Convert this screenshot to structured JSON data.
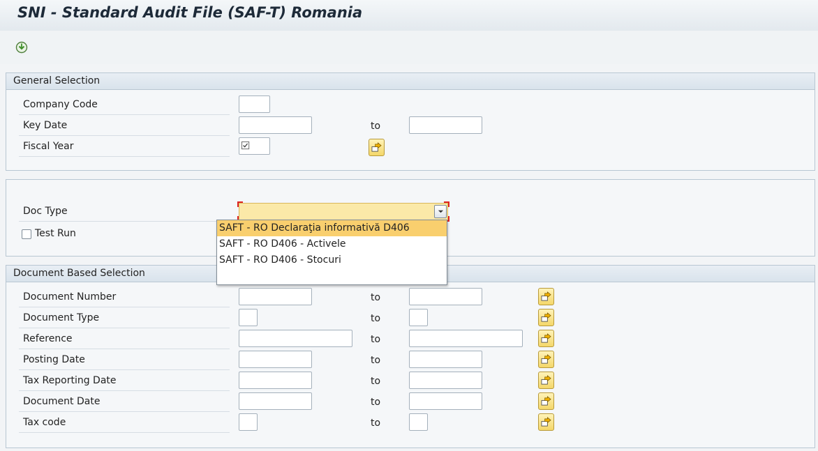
{
  "title": "SNI - Standard Audit File (SAF-T) Romania",
  "toolbar": {
    "execute_icon": "execute-icon"
  },
  "general": {
    "header": "General Selection",
    "company_code_label": "Company Code",
    "key_date_label": "Key Date",
    "key_date_to": "to",
    "fiscal_year_label": "Fiscal Year"
  },
  "options": {
    "doc_type_label": "Doc Type",
    "test_run_label": "Test Run",
    "doc_type_options": [
      "SAFT - RO Declaraţia informativă D406",
      "SAFT - RO D406 - Activele",
      "SAFT - RO D406 - Stocuri"
    ]
  },
  "docsel": {
    "header": "Document Based Selection",
    "rows": [
      {
        "label": "Document Number",
        "to": "to"
      },
      {
        "label": "Document Type",
        "to": "to"
      },
      {
        "label": "Reference",
        "to": "to"
      },
      {
        "label": "Posting Date",
        "to": "to"
      },
      {
        "label": "Tax Reporting Date",
        "to": "to"
      },
      {
        "label": "Document Date",
        "to": "to"
      },
      {
        "label": "Tax code",
        "to": "to"
      }
    ]
  },
  "colors": {
    "accent": "#f4d76a",
    "selected": "#f9cf6e",
    "header_bg": "#d9e3ec"
  }
}
